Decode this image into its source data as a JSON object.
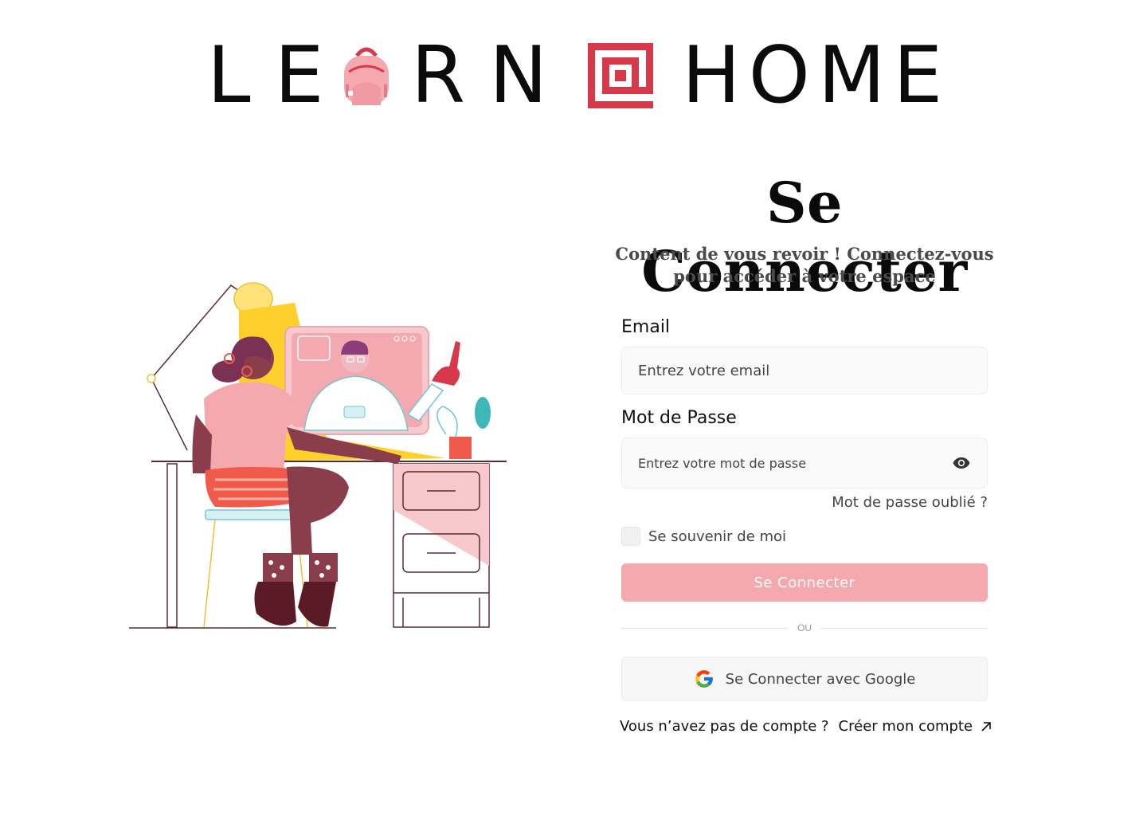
{
  "logo": {
    "word1": "LE",
    "word2": "RN",
    "word3": "HOME"
  },
  "login": {
    "title": "Se Connecter",
    "subtitle": "Content de vous revoir ! Connectez-vous pour accéder à votre espace",
    "email_label": "Email",
    "email_placeholder": "Entrez votre email",
    "password_label": "Mot de Passe",
    "password_placeholder": "Entrez votre mot de passe",
    "forgot_link": "Mot de passe oublié ?",
    "remember_label": "Se souvenir de moi",
    "submit_label": "Se Connecter",
    "divider_text": "OU",
    "google_label": "Se Connecter avec Google",
    "no_account_text": "Vous n’avez pas de compte ?",
    "create_account_link": "Créer mon compte"
  },
  "icons": {
    "password_toggle": "eye-icon",
    "google": "google-icon",
    "external_link": "arrow-up-right-icon"
  },
  "colors": {
    "accent_pink": "#f5a8ae",
    "brand_red": "#d63a4a",
    "illustration_yellow": "#ffd02b",
    "illustration_maroon": "#8a3d4a"
  }
}
